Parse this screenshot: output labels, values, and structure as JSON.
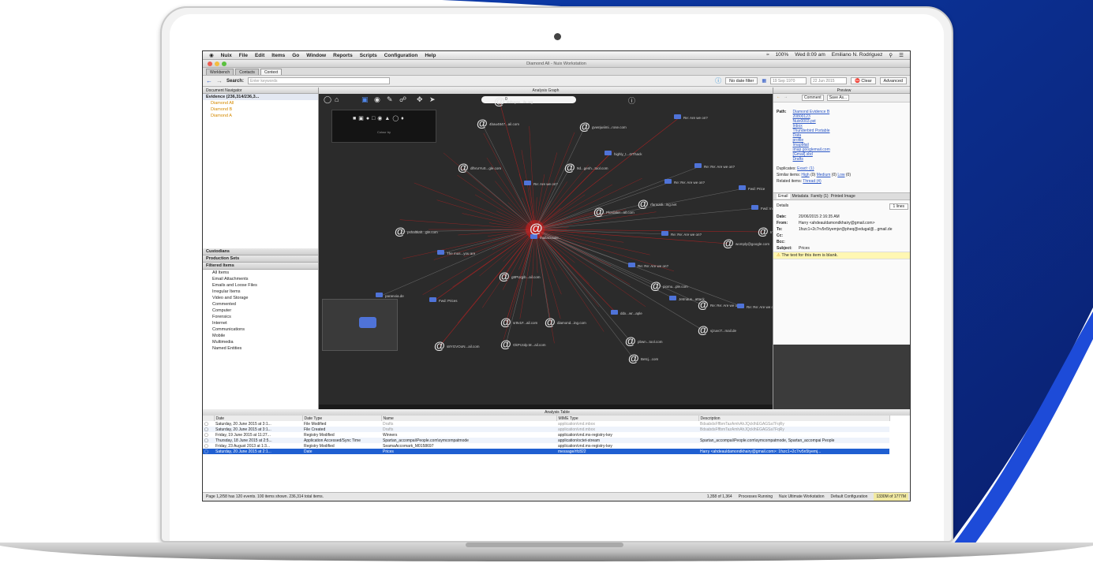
{
  "menubar": {
    "apple": "",
    "app": "Nuix",
    "items": [
      "File",
      "Edit",
      "Items",
      "Go",
      "Window",
      "Reports",
      "Scripts",
      "Configuration",
      "Help"
    ],
    "clock": "Wed 8:09 am",
    "user": "Emiliano N. Rodriguez",
    "battery": "100%"
  },
  "window": {
    "title": "Diamond All - Nuix Workstation"
  },
  "tabs": [
    {
      "label": "Workbench"
    },
    {
      "label": "Contacts"
    },
    {
      "label": "Context"
    }
  ],
  "search": {
    "label": "Search:",
    "placeholder": "Enter keywords",
    "date_filter": "No date filter",
    "date_from": "19 Sep 1970",
    "date_to": "22 Jun 2015",
    "clear": "Clear",
    "advanced": "Advanced"
  },
  "navigator": {
    "header": "Document Navigator",
    "evidence_root": "Evidence (236,314/236,3...",
    "evidence_items": [
      "Diamond All",
      "Diamond B",
      "Diamond A"
    ],
    "sections": [
      "Custodians",
      "Production Sets",
      "Filtered Items"
    ],
    "filtered_items": [
      "All Items",
      "Email Attachments",
      "Emails and Loose Files",
      "Irregular Items",
      "Video and Storage",
      "Commented",
      "Computer",
      "Forensics",
      "Internet",
      "Communications",
      "Mobile",
      "Multimedia",
      "Named Entities"
    ]
  },
  "graph": {
    "header": "Analysis Graph",
    "search_value": "0",
    "legend": "Colour by",
    "nodes": [
      {
        "label": "dobuyas...ilu.org"
      },
      {
        "label": "4bau4847...ail.com"
      },
      {
        "label": "gvwnjwiimi...rose.com"
      },
      {
        "label": "Re: Are we on?"
      },
      {
        "label": "dllVurYuS...gle.com"
      },
      {
        "label": "9d...genh...tool.com"
      },
      {
        "label": "highly_t...4rThack"
      },
      {
        "label": "Re: Re: Are we on?"
      },
      {
        "label": "Re: Re: Are we on?"
      },
      {
        "label": "Re: Are we on?"
      },
      {
        "label": "rfantoldi...ing.net"
      },
      {
        "label": "Fwd: Price"
      },
      {
        "label": "Plordaler...ail.com"
      },
      {
        "label": "Fwd: Ins...ps"
      },
      {
        "label": "pshaltkah...gle.com"
      },
      {
        "label": "Inkt Hvt...u-fo"
      },
      {
        "label": "Re: Re: Are we on?"
      },
      {
        "label": "mailaccaule..."
      },
      {
        "label": "womply@google.com"
      },
      {
        "label": "The mus...you are"
      },
      {
        "label": "Re: Re: Are we on?"
      },
      {
        "label": "g8PUqyb...ail.com"
      },
      {
        "label": "piomu...ple.com"
      },
      {
        "label": "paranoia.de"
      },
      {
        "label": "Fwd: Prices"
      },
      {
        "label": "Jetmaus...attack"
      },
      {
        "label": "Re: Re: Are we on?"
      },
      {
        "label": "sr8v1F...ail.com"
      },
      {
        "label": "Re: Re: Are we on?"
      },
      {
        "label": "vjzuvcT...mail.de"
      },
      {
        "label": "s8YGVOoN...ail.com"
      },
      {
        "label": "pbwn...tool.com"
      },
      {
        "label": "diamond...ing.com"
      },
      {
        "label": "ddx...wr...aple"
      },
      {
        "label": "OkPrJolp.M...ail.com"
      },
      {
        "label": "Betcj...com"
      }
    ]
  },
  "preview": {
    "header": "Preview",
    "comment_btn": "Comment",
    "save_btn": "Save As...",
    "path_label": "Path:",
    "path_items": [
      "Diamond Evidence B",
      "20800123",
      "Nuix0003.pst",
      "Inbox",
      "Thunderbird Portable",
      "Data",
      "profile",
      "ImapMail",
      "imap.googlemail.com",
      "[Gmail].sbd",
      "Drafts"
    ],
    "duplicates_label": "Duplicates:",
    "duplicates_value": "Exact: (1)",
    "similar_label": "Similar items:",
    "similar_values": [
      "High",
      "(0)",
      "Medium",
      "(0)",
      "Low",
      "(0)"
    ],
    "related_label": "Related items:",
    "related_value": "Thread (4)",
    "tabs": [
      "Email",
      "Metadata",
      "Family (1)",
      "Printed Image"
    ],
    "details_label": "Details",
    "details_fmt": "1 lines",
    "fields": [
      {
        "k": "Date:",
        "v": "20/06/2015 2:16:35 AM"
      },
      {
        "k": "From:",
        "v": "Harry <ahdeauldamondkhairy@gmail.com>"
      },
      {
        "k": "To:",
        "v": "1fszc1+2c7rv5n5tyemjvr@pheq@edugal@...gmail.de"
      },
      {
        "k": "Cc:",
        "v": ""
      },
      {
        "k": "Bcc:",
        "v": ""
      },
      {
        "k": "Subject:",
        "v": "Prices"
      }
    ],
    "notice": "The text for this item is blank."
  },
  "table": {
    "header": "Analysis Table",
    "columns": [
      "Date",
      "Date Type",
      "Name",
      "MIME Type",
      "Description"
    ],
    "rows": [
      {
        "date": "Saturday, 20 June 2015 at 3:1...",
        "type": "File Modified",
        "name": "Drafts",
        "mime": "application/vnd.mbox",
        "desc": "BdsabdsFffbmTazAmhAhJQcklhEGAGSa7FqRy"
      },
      {
        "date": "Saturday, 20 June 2015 at 3:1...",
        "type": "File Created",
        "name": "Drafts",
        "mime": "application/vnd.mbox",
        "desc": "BdsabdsFffbmTazAmhAhJQcklhEGAGSa7FqRy"
      },
      {
        "date": "Friday, 19 June 2015 at 11:27...",
        "type": "Registry Modified",
        "name": "Winners",
        "mime": "application/vnd.ms-registry-key",
        "desc": ""
      },
      {
        "date": "Thursday, 18 June 2015 at 2:5...",
        "type": "Application Accessed/Sync Time",
        "name": "Spartan_accompai\\People.com\\symcompatmode",
        "mime": "application/octet-stream",
        "desc": "Spartan_accompai\\People.com\\symcompatmode, Spartan_accompai People"
      },
      {
        "date": "Friday, 23 August 2013 at 1:3...",
        "type": "Registry Modified",
        "name": "SeamaAccomark_M0158697",
        "mime": "application/vnd.ms-registry-key",
        "desc": ""
      },
      {
        "date": "Saturday, 20 June 2015 at 2:1...",
        "type": "Date",
        "name": "Prices",
        "mime": "message/rfc822",
        "desc": "Harry <ahdeauldamondkhairy@gmail.com>: 1fszc1+2c7rv5n5tyemj..."
      }
    ]
  },
  "statusbar": {
    "left": "Page 1,2/58 has 120 events. 100 items shown. 236,314 total items.",
    "pager": "1,358 of 1,364",
    "processes": "Processes Running",
    "product": "Nuix Ultimate Workstation",
    "config": "Default Configuration",
    "memory": "1330M of 1777M"
  },
  "colors": {
    "accent": "#1f5fd1",
    "graph_bg": "#2b2b2b",
    "edge_red": "#d31f1f",
    "brand_blue": "#0d2f9a"
  }
}
